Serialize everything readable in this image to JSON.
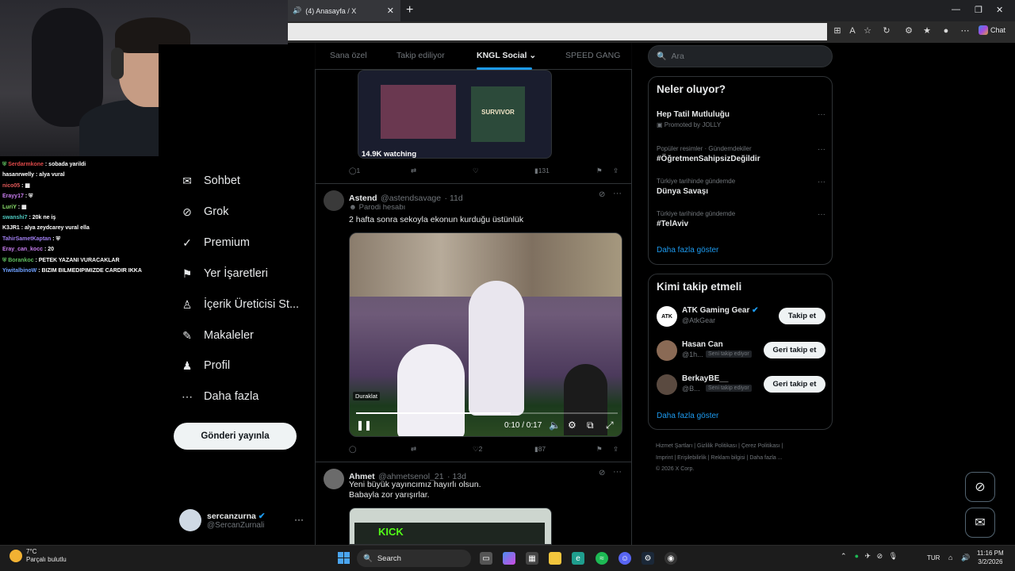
{
  "browser": {
    "tab_title": "(4) Anasayfa / X",
    "tab_close": "✕",
    "new_tab": "+",
    "chat_label": "Chat",
    "window_controls": [
      "—",
      "❐",
      "✕"
    ]
  },
  "stream_chat": {
    "messages": [
      {
        "user": "Serdarmkone",
        "text": ": sobada yarildi",
        "color": "#e04a4a",
        "badge": "⛨"
      },
      {
        "user": "hasanrwelly",
        "text": ": alya vural",
        "color": "#ffffff"
      },
      {
        "user": "nico05",
        "text": ": ▦",
        "color": "#e05858"
      },
      {
        "user": "Erayy17",
        "text": ": ⛨",
        "color": "#c97ef0"
      },
      {
        "user": "LuriY",
        "text": ": ▦",
        "color": "#8be06d"
      },
      {
        "user": "swanshi7",
        "text": ": 20k ne iş",
        "color": "#4ec9c0"
      },
      {
        "user": "K3JR1",
        "text": ": alya zeydcarey vural ella",
        "color": "#ffffff"
      },
      {
        "user": "TahirSametKaptan",
        "text": ": ⛨",
        "color": "#a07ef0"
      },
      {
        "user": "Eray_can_kocc",
        "text": ": 20",
        "color": "#c97ef0"
      },
      {
        "user": "Borankoc",
        "text": ": PETEK YAZANI VURACAKLAR",
        "color": "#5fbf5f",
        "badge": "⛨"
      },
      {
        "user": "YiwitalbinoW",
        "text": ": BIZIM BILMEDIPIMIZDE CARDIR IKKA",
        "color": "#6ea0ff"
      }
    ]
  },
  "nav": {
    "items": [
      {
        "label": "Sohbet",
        "icon": "✉"
      },
      {
        "label": "Grok",
        "icon": "⊘"
      },
      {
        "label": "Premium",
        "icon": "✓"
      },
      {
        "label": "Yer İşaretleri",
        "icon": "⚑"
      },
      {
        "label": "İçerik Üreticisi St...",
        "icon": "♙"
      },
      {
        "label": "Makaleler",
        "icon": "✎"
      },
      {
        "label": "Profil",
        "icon": "♟"
      },
      {
        "label": "Daha fazla",
        "icon": "⋯"
      }
    ],
    "post_button": "Gönderi yayınla",
    "account": {
      "name": "sercanzurna",
      "handle": "@SercanZurnali",
      "more": "···"
    }
  },
  "feed": {
    "tabs": [
      "Sana özel",
      "Takip ediliyor",
      "KNGL Social",
      "SPEED GANG"
    ],
    "active_tab": "KNGL Social",
    "active_tab_chevron": "⌄",
    "post0": {
      "image_overlay": "14.9K watching",
      "image_panel_text": "SURVIVOR",
      "replies": "1",
      "likes": "",
      "views": "131"
    },
    "post1": {
      "name": "Astend",
      "handle": "@astendsavage",
      "time": "· 11d",
      "parody_label": "Parodi hesabı",
      "text": "2 hafta sonra sekoyla ekonun kurduğu üstünlük",
      "video": {
        "paused_label": "Duraklat",
        "time": "0:10 / 0:17",
        "progress": 0.59
      },
      "replies": "",
      "likes": "2",
      "views": "87"
    },
    "post2": {
      "name": "Ahmet",
      "handle": "@ahmetsenol_21",
      "time": "· 13d",
      "text_line1": "Yeni büyük yayıncımız hayırlı olsun.",
      "text_line2": "Babayla zor yarışırlar.",
      "image_text": "KICK"
    }
  },
  "sidebar": {
    "search_placeholder": "Ara",
    "trends_title": "Neler oluyor?",
    "trends": [
      {
        "context": "Promoted by JOLLY",
        "title": "Hep Tatil Mutluluğu",
        "promoted": true
      },
      {
        "context": "Popüler resimler · Gündemdekiler",
        "title": "#ÖğretmenSahipsizDeğildir"
      },
      {
        "context": "Türkiye tarihinde gündemde",
        "title": "Dünya Savaşı"
      },
      {
        "context": "Türkiye tarihinde gündemde",
        "title": "#TelAviv"
      }
    ],
    "trends_more": "Daha fazla göster",
    "who_title": "Kimi takip etmeli",
    "who": [
      {
        "name": "ATK Gaming Gear",
        "handle": "@AtkGear",
        "button": "Takip et",
        "avatar_text": "ATK"
      },
      {
        "name": "Hasan Can",
        "handle": "@1h...",
        "tag": "Seni takip ediyor",
        "button": "Geri takip et"
      },
      {
        "name": "BerkayBE__",
        "handle": "@B...",
        "tag": "Seni takip ediyor",
        "button": "Geri takip et"
      }
    ],
    "who_more": "Daha fazla göster",
    "footer": [
      "Hizmet Şartları",
      "|",
      "Gizlilik Politikası",
      "|",
      "Çerez Politikası",
      "|",
      "Imprint",
      "|",
      "Erişilebilirlik",
      "|",
      "Reklam bilgisi",
      "|",
      "Daha fazla ...",
      "© 2026 X Corp."
    ]
  },
  "taskbar": {
    "temp": "7°C",
    "weather": "Parçalı bulutlu",
    "search": "Search",
    "lang": "TUR",
    "time": "11:16 PM",
    "date": "3/2/2026"
  },
  "colors": {
    "accent": "#1d9bf0",
    "bg": "#000000",
    "border": "#2f3336",
    "muted": "#71767b"
  }
}
